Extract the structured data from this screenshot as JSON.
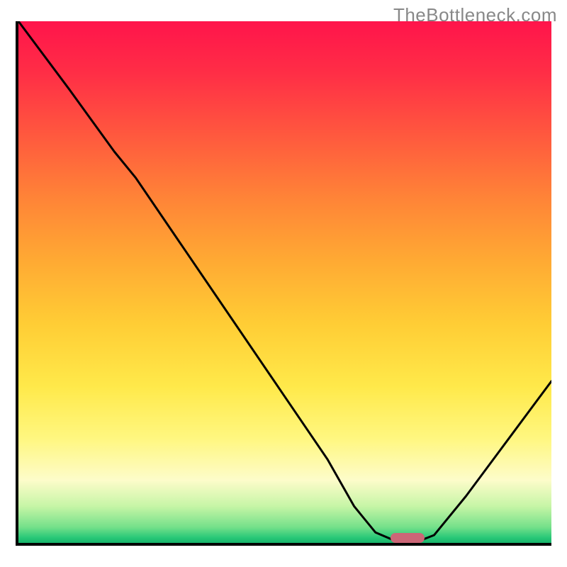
{
  "watermark": "TheBottleneck.com",
  "chart_data": {
    "type": "line",
    "title": "",
    "xlabel": "",
    "ylabel": "",
    "xlim": [
      0,
      100
    ],
    "ylim": [
      0,
      100
    ],
    "grid": false,
    "legend": false,
    "curve": {
      "note": "Black bottleneck curve; values are (x%, y%) within the plot rectangle, y measured from the BOTTOM axis (0 = bottom, 100 = top), read off the pixels.",
      "points": [
        {
          "x": 0,
          "y": 100
        },
        {
          "x": 9.5,
          "y": 87
        },
        {
          "x": 18,
          "y": 75
        },
        {
          "x": 22,
          "y": 70
        },
        {
          "x": 30,
          "y": 58
        },
        {
          "x": 40,
          "y": 43
        },
        {
          "x": 50,
          "y": 28
        },
        {
          "x": 58,
          "y": 16
        },
        {
          "x": 63,
          "y": 7
        },
        {
          "x": 67,
          "y": 2
        },
        {
          "x": 70,
          "y": 0.7
        },
        {
          "x": 76,
          "y": 0.7
        },
        {
          "x": 78,
          "y": 1.5
        },
        {
          "x": 84,
          "y": 9
        },
        {
          "x": 92,
          "y": 20
        },
        {
          "x": 100,
          "y": 31
        }
      ]
    },
    "optimal_marker": {
      "note": "Rounded pink marker at the curve minimum near the x-axis",
      "x_center_pct": 73,
      "y_center_pct": 1.0,
      "width_pct": 6.5,
      "height_pct": 1.9,
      "color": "#cc6677"
    },
    "background_gradient": {
      "direction": "vertical",
      "stops": [
        {
          "pct": 0,
          "color": "#ff144b"
        },
        {
          "pct": 22,
          "color": "#ff593e"
        },
        {
          "pct": 46,
          "color": "#ffaa33"
        },
        {
          "pct": 70,
          "color": "#ffe94a"
        },
        {
          "pct": 88,
          "color": "#fdfcca"
        },
        {
          "pct": 97,
          "color": "#74e08a"
        },
        {
          "pct": 100,
          "color": "#17b36a"
        }
      ]
    }
  }
}
